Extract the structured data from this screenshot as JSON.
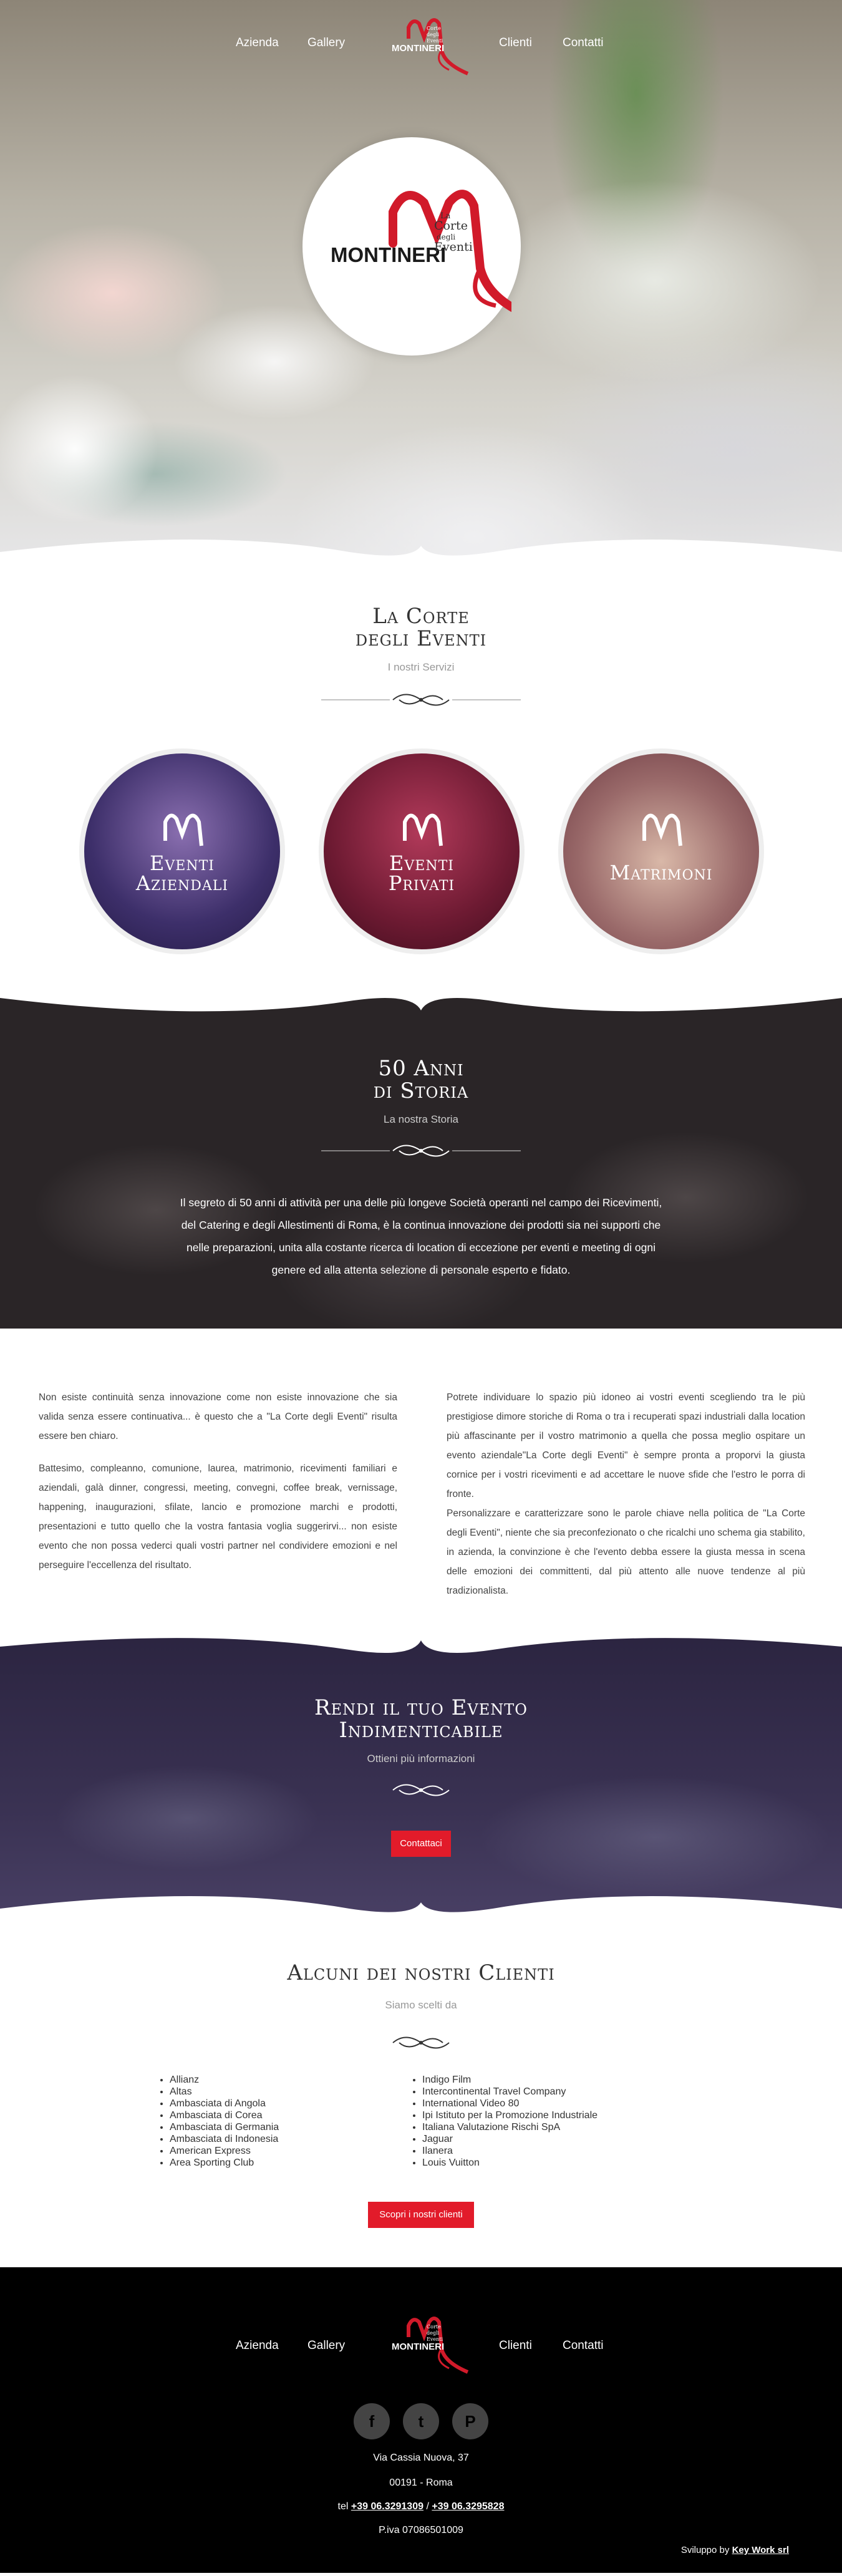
{
  "nav": {
    "left": [
      "Azienda",
      "Gallery"
    ],
    "right": [
      "Clienti",
      "Contatti"
    ],
    "logo_text": "MONTINERI",
    "logo_small": [
      "La",
      "Corte",
      "degli",
      "Eventi"
    ]
  },
  "hero": {
    "logo_text": "MONTINERI",
    "logo_small": [
      "La",
      "Corte",
      "degli",
      "Eventi"
    ]
  },
  "servizi": {
    "title_line1": "La Corte",
    "title_line2": "degli Eventi",
    "subtitle": "I nostri Servizi",
    "items": [
      {
        "line1": "Eventi",
        "line2": "Aziendali"
      },
      {
        "line1": "Eventi",
        "line2": "Privati"
      },
      {
        "line1": "Matrimoni",
        "line2": ""
      }
    ]
  },
  "storia": {
    "title_line1": "50 Anni",
    "title_line2": "di Storia",
    "subtitle": "La nostra Storia",
    "text": "Il segreto di 50 anni di attività per una delle più longeve Società operanti nel campo dei Ricevimenti, del Catering e degli Allestimenti di Roma, è la continua innovazione dei prodotti sia nei supporti che nelle preparazioni, unita alla costante ricerca di location di eccezione per eventi e meeting di ogni genere ed alla attenta selezione di personale esperto e fidato."
  },
  "info": {
    "left": [
      "Non esiste continuità senza innovazione come non esiste innovazione che sia valida senza essere continuativa... è questo che a \"La Corte degli Eventi\" risulta essere ben chiaro.",
      "Battesimo, compleanno, comunione, laurea, matrimonio, ricevimenti familiari e aziendali, galà dinner, congressi, meeting, convegni, coffee break, vernissage, happening, inaugurazioni, sfilate, lancio e promozione marchi e prodotti, presentazioni e tutto quello che la vostra fantasia voglia suggerirvi... non esiste evento che non possa vederci quali vostri partner nel condividere emozioni e nel perseguire l'eccellenza del risultato."
    ],
    "right": [
      "Potrete individuare lo spazio più idoneo ai vostri eventi scegliendo tra le più prestigiose dimore storiche di Roma o tra i recuperati spazi industriali dalla location più affascinante per il vostro matrimonio a quella che possa meglio ospitare un evento aziendale\"La Corte degli Eventi\" è sempre pronta a proporvi la giusta cornice per i vostri ricevimenti e ad accettare le nuove sfide che l'estro le porra di fronte.",
      "Personalizzare e caratterizzare sono le parole chiave nella politica de \"La Corte degli Eventi\", niente che sia preconfezionato o che ricalchi uno schema gia stabilito, in azienda, la convinzione è che l'evento debba essere la giusta messa in scena delle emozioni dei committenti, dal più attento alle nuove tendenze al più tradizionalista."
    ]
  },
  "cta": {
    "title_line1": "Rendi il tuo Evento",
    "title_line2": "Indimenticabile",
    "subtitle": "Ottieni più informazioni",
    "button": "Contattaci"
  },
  "clienti": {
    "title": "Alcuni dei nostri Clienti",
    "subtitle": "Siamo scelti da",
    "col1": [
      "Allianz",
      "Altas",
      "Ambasciata di Angola",
      "Ambasciata di Corea",
      "Ambasciata di Germania",
      "Ambasciata di Indonesia",
      "American Express",
      "Area Sporting Club"
    ],
    "col2": [
      "Indigo Film",
      "Intercontinental Travel Company",
      "International Video 80",
      "Ipi Istituto per la Promozione Industriale",
      "Italiana Valutazione Rischi SpA",
      "Jaguar",
      "Ilanera",
      "Louis Vuitton"
    ],
    "button": "Scopri i nostri clienti"
  },
  "footer": {
    "left": [
      "Azienda",
      "Gallery"
    ],
    "right": [
      "Clienti",
      "Contatti"
    ],
    "social": [
      {
        "icon": "facebook-icon",
        "glyph": "f"
      },
      {
        "icon": "twitter-icon",
        "glyph": "t"
      },
      {
        "icon": "pinterest-icon",
        "glyph": "P"
      }
    ],
    "address": "Via Cassia Nuova, 37",
    "city": "00191 - Roma",
    "tel_label": "tel",
    "tel1": "+39 06.3291309",
    "tel_sep": "/",
    "tel2": "+39 06.3295828",
    "piva": "P.iva 07086501009",
    "credit_prefix": "Sviluppo by",
    "credit_link": "Key Work srl"
  },
  "colors": {
    "accent": "#e21b2a",
    "dark": "#2a2527",
    "footer": "#000000"
  }
}
